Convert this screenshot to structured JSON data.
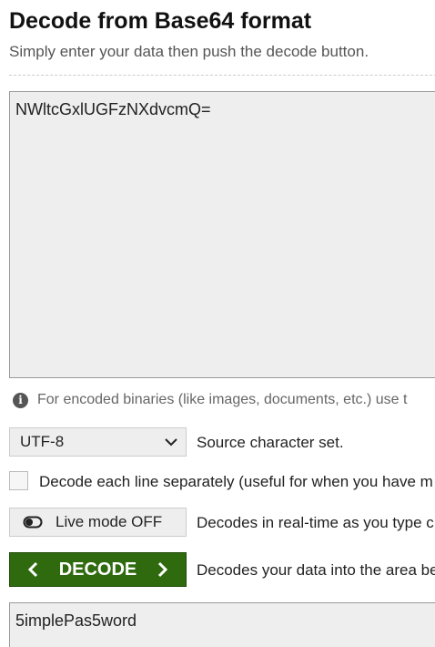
{
  "header": {
    "title": "Decode from Base64 format",
    "subtitle": "Simply enter your data then push the decode button."
  },
  "input": {
    "value": "NWltcGxlUGFzNXdvcmQ="
  },
  "info": {
    "icon": "info-icon",
    "text": "For encoded binaries (like images, documents, etc.) use t"
  },
  "charset": {
    "selected": "UTF-8",
    "description": "Source character set."
  },
  "line_option": {
    "label": "Decode each line separately (useful for when you have m"
  },
  "live_mode": {
    "label": "Live mode OFF",
    "description": "Decodes in real-time as you type c"
  },
  "decode": {
    "label": "DECODE",
    "description": "Decodes your data into the area be",
    "color": "#2f6a0f"
  },
  "output": {
    "value": "5implePas5word"
  }
}
